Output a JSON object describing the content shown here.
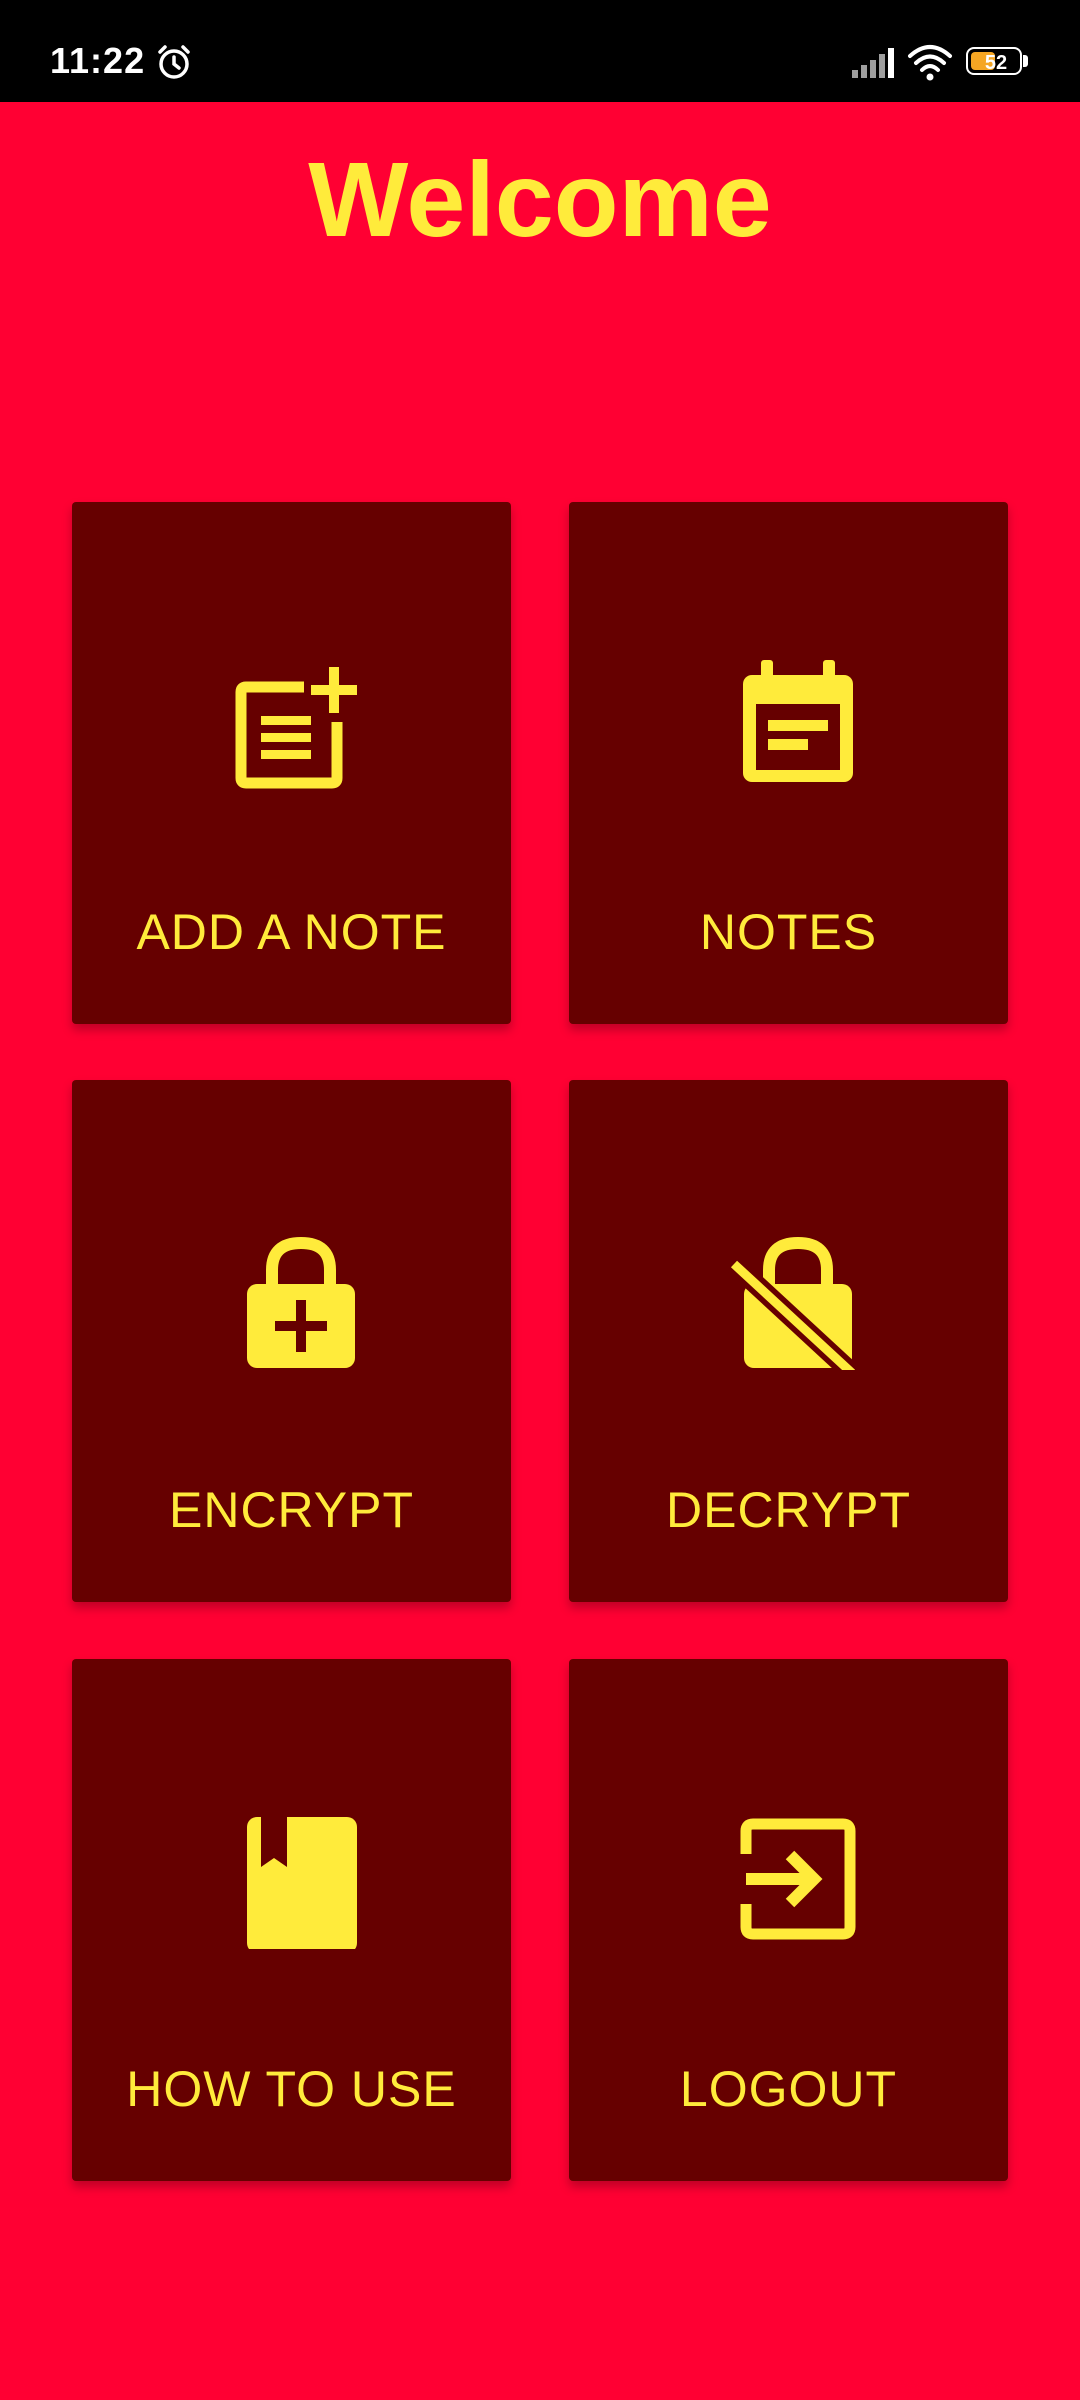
{
  "status_bar": {
    "time": "11:22",
    "battery_percent": "52",
    "battery_level": 0.52
  },
  "colors": {
    "background": "#FF0033",
    "tile": "#660000",
    "accent": "#FFEB3B"
  },
  "title": "Welcome",
  "tiles": [
    {
      "label": "ADD A NOTE",
      "icon": "note-add-icon"
    },
    {
      "label": "NOTES",
      "icon": "calendar-note-icon"
    },
    {
      "label": "ENCRYPT",
      "icon": "lock-plus-icon"
    },
    {
      "label": "DECRYPT",
      "icon": "lock-off-icon"
    },
    {
      "label": "HOW TO USE",
      "icon": "book-bookmark-icon"
    },
    {
      "label": "LOGOUT",
      "icon": "logout-icon"
    }
  ]
}
